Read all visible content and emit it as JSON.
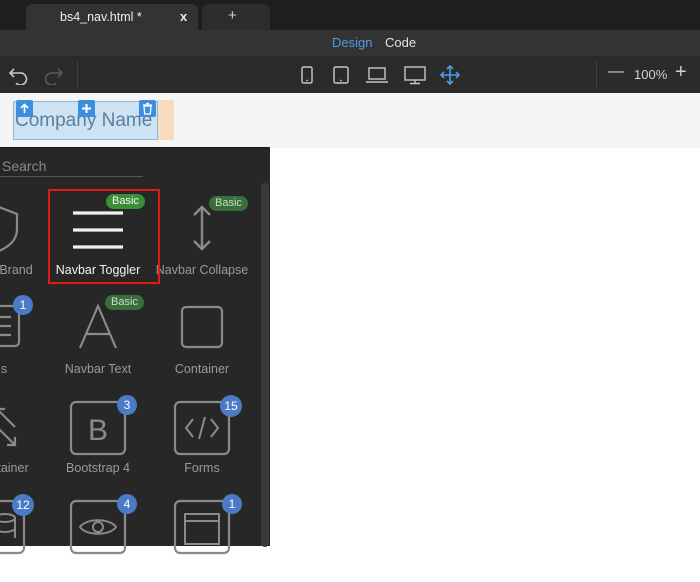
{
  "tabs": {
    "file_title": "bs4_nav.html *",
    "file_close": "x",
    "new_tab": "+"
  },
  "view": {
    "design": "Design",
    "code": "Code"
  },
  "toolbar": {
    "zoom": "100%",
    "zoom_out": "—",
    "zoom_in": "+"
  },
  "canvas": {
    "brand_text": "Company Name"
  },
  "panel": {
    "search_placeholder": "Search",
    "components": [
      {
        "label": "Brand",
        "icon": "shield-icon",
        "badge": ""
      },
      {
        "label": "Navbar Toggler",
        "icon": "hamburger-icon",
        "badge": "Basic"
      },
      {
        "label": "Navbar Collapse",
        "icon": "vertical-resize-arrow-icon",
        "badge": "Basic"
      },
      {
        "label": "s",
        "icon": "list-icon",
        "badge": "1"
      },
      {
        "label": "Navbar Text",
        "icon": "text-a-icon",
        "badge": "Basic"
      },
      {
        "label": "Container",
        "icon": "square-icon",
        "badge": ""
      },
      {
        "label": "tainer",
        "icon": "expand-arrows-icon",
        "badge": ""
      },
      {
        "label": "Bootstrap 4",
        "icon": "bootstrap-b-icon",
        "badge": "3"
      },
      {
        "label": "Forms",
        "icon": "code-brackets-icon",
        "badge": "15"
      },
      {
        "label": "",
        "icon": "database-icon",
        "badge": "12"
      },
      {
        "label": "",
        "icon": "eye-icon",
        "badge": "4"
      },
      {
        "label": "",
        "icon": "window-icon",
        "badge": "1"
      }
    ]
  },
  "colors": {
    "accent": "#4d9be8",
    "basic_badge": "#3c8c3c",
    "count_badge": "#4a7bc4",
    "highlight": "#e11a1a"
  }
}
